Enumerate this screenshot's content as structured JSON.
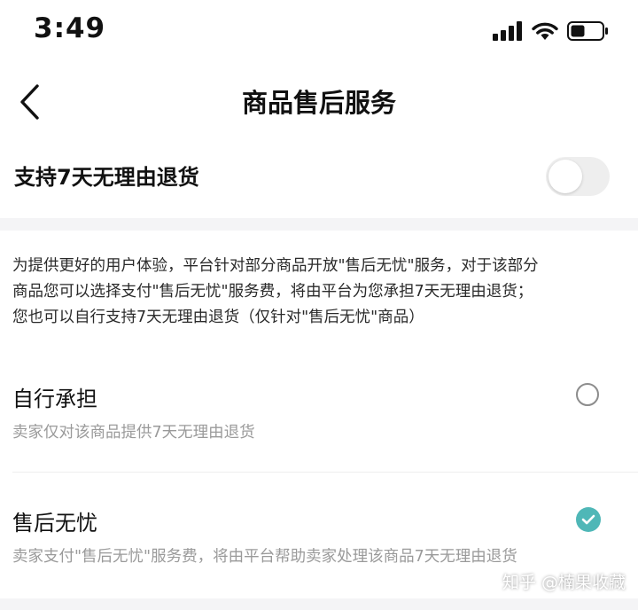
{
  "status_bar": {
    "time": "3:49",
    "icons": [
      "cellular-signal-icon",
      "wifi-icon",
      "battery-icon"
    ]
  },
  "nav": {
    "back_icon": "chevron-left-icon",
    "title": "商品售后服务"
  },
  "toggle_row": {
    "label": "支持7天无理由退货",
    "enabled": false
  },
  "description": {
    "lines": [
      "为提供更好的用户体验，平台针对部分商品开放\"售后无忧\"服务，对于该部分",
      "商品您可以选择支付\"售后无忧\"服务费，将由平台为您承担7天无理由退货；",
      "您也可以自行支持7天无理由退货（仅针对\"售后无忧\"商品）"
    ]
  },
  "options": [
    {
      "title": "自行承担",
      "subtitle": "卖家仅对该商品提供7天无理由退货",
      "selected": false
    },
    {
      "title": "售后无忧",
      "subtitle": "卖家支付\"售后无忧\"服务费，将由平台帮助卖家处理该商品7天无理由退货",
      "selected": true
    }
  ],
  "watermark": "知乎 @楠果收藏",
  "colors": {
    "accent": "#4fb7b7",
    "toggle_off": "#eeeeee",
    "secondary_text": "#9a9a9a",
    "band": "#f4f4f6"
  }
}
